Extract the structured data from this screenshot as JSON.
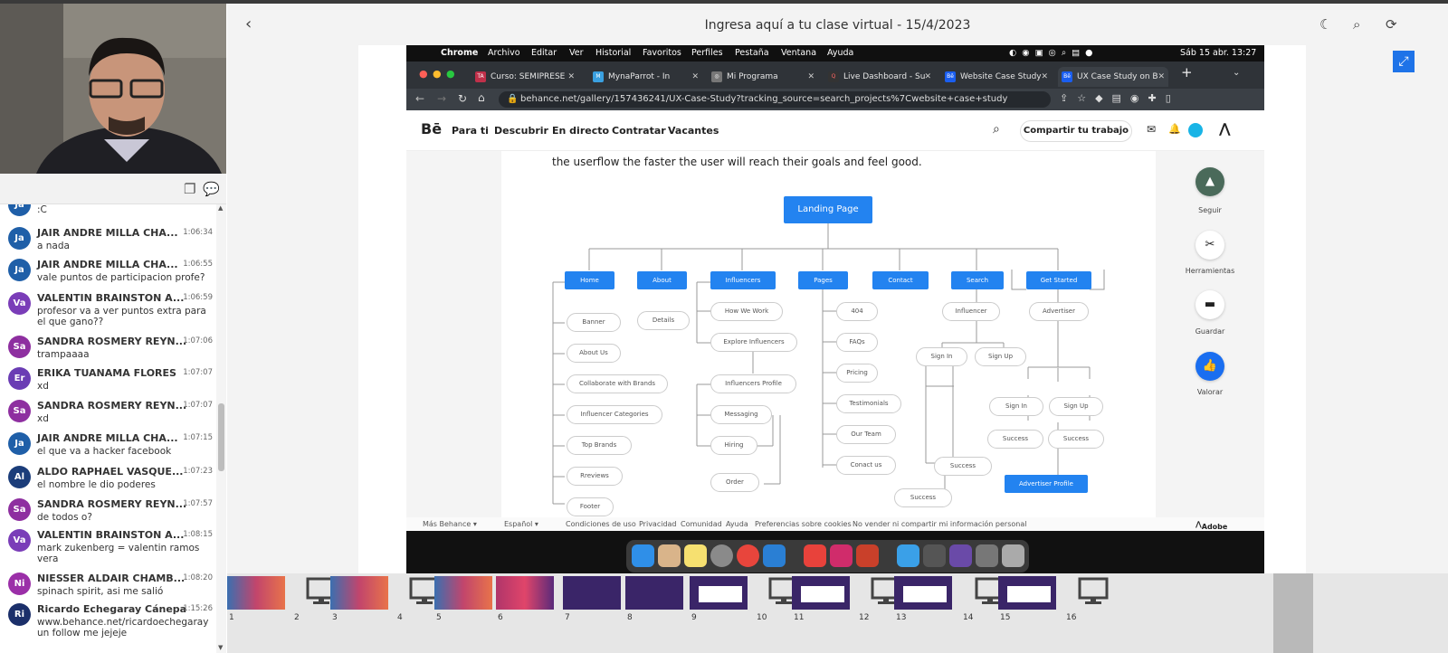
{
  "header": {
    "title": "Ingresa aquí a tu clase virtual - 15/4/2023",
    "back_icon": "chevron-left-icon",
    "theme_icon": "moon-icon",
    "search_icon": "search-icon",
    "rotate_icon": "rotate-icon"
  },
  "chat": {
    "messages": [
      {
        "initials": "Ja",
        "color": "#1f5fa8",
        "name": "",
        "time": "",
        "text": ":C"
      },
      {
        "initials": "Ja",
        "color": "#1f5fa8",
        "name": "JAIR ANDRE MILLA CHA...",
        "time": "1:06:34",
        "text": "a nada"
      },
      {
        "initials": "Ja",
        "color": "#1f5fa8",
        "name": "JAIR ANDRE MILLA CHA...",
        "time": "1:06:55",
        "text": "vale puntos de participacion profe?"
      },
      {
        "initials": "Va",
        "color": "#7a3db8",
        "name": "VALENTIN BRAINSTON A...",
        "time": "1:06:59",
        "text": "profesor va a ver puntos extra para el que gano??"
      },
      {
        "initials": "Sa",
        "color": "#8e2fa0",
        "name": "SANDRA ROSMERY REYN...",
        "time": "1:07:06",
        "text": "trampaaaa"
      },
      {
        "initials": "Er",
        "color": "#6a3cb4",
        "name": "ERIKA TUANAMA FLORES",
        "time": "1:07:07",
        "text": "xd"
      },
      {
        "initials": "Sa",
        "color": "#8e2fa0",
        "name": "SANDRA ROSMERY REYN...",
        "time": "1:07:07",
        "text": "xd"
      },
      {
        "initials": "Ja",
        "color": "#1f5fa8",
        "name": "JAIR ANDRE MILLA CHA...",
        "time": "1:07:15",
        "text": "el que va a hacker facebook"
      },
      {
        "initials": "Al",
        "color": "#1b3d7a",
        "name": "ALDO RAPHAEL VASQUE...",
        "time": "1:07:23",
        "text": "el nombre le dio poderes"
      },
      {
        "initials": "Sa",
        "color": "#8e2fa0",
        "name": "SANDRA ROSMERY REYN...",
        "time": "1:07:57",
        "text": "de todos o?"
      },
      {
        "initials": "Va",
        "color": "#7a3db8",
        "name": "VALENTIN BRAINSTON A...",
        "time": "1:08:15",
        "text": "mark zukenberg = valentin ramos vera"
      },
      {
        "initials": "Ni",
        "color": "#9b2fa8",
        "name": "NIESSER ALDAIR CHAMB...",
        "time": "1:08:20",
        "text": "spinach spirit, asi me salió"
      },
      {
        "initials": "Ri",
        "color": "#1b2f6a",
        "name": "Ricardo Echegaray Cánepa",
        "time": "1:15:26",
        "text": "www.behance.net/ricardoechegaray un follow me jejeje"
      }
    ]
  },
  "mac": {
    "menubar": [
      "Chrome",
      "Archivo",
      "Editar",
      "Ver",
      "Historial",
      "Favoritos",
      "Perfiles",
      "Pestaña",
      "Ventana",
      "Ayuda"
    ],
    "clock": "Sáb 15 abr. 13:27",
    "tabs": [
      "Curso: SEMIPRESE",
      "MynaParrot - In",
      "Mi Programa",
      "Live Dashboard - Su",
      "Website Case Study",
      "UX Case Study on B"
    ],
    "url": "behance.net/gallery/157436241/UX-Case-Study?tracking_source=search_projects%7Cwebsite+case+study",
    "behance": {
      "logo": "Bē",
      "nav": [
        "Para ti",
        "Descubrir",
        "En directo",
        "Contratar",
        "Vacantes"
      ],
      "share": "Compartir tu trabajo"
    },
    "intro": "the userflow the faster the user will reach their goals and feel good.",
    "landing": "Landing Page",
    "sections": [
      "Home",
      "About",
      "Influencers",
      "Pages",
      "Contact",
      "Search",
      "Get Started"
    ],
    "home_items": [
      "Banner",
      "About Us",
      "Collaborate with Brands",
      "Influencer Categories",
      "Top Brands",
      "Rreviews",
      "Footer"
    ],
    "about_items": [
      "Details"
    ],
    "influencer_items": [
      "How We Work",
      "Explore Influencers",
      "Influencers Profile",
      "Messaging",
      "Hiring",
      "Order"
    ],
    "pages_items": [
      "404",
      "FAQs",
      "Pricing",
      "Testimonials",
      "Our Team",
      "Conact us"
    ],
    "search_items": [
      "Influencer",
      "Sign In",
      "Sign Up",
      "Success",
      "Success"
    ],
    "started_items": [
      "Advertiser",
      "Sign In",
      "Sign Up",
      "Success",
      "Success",
      "Advertiser Profile"
    ],
    "side_actions": [
      "Seguir",
      "Herramientas",
      "Guardar",
      "Valorar"
    ],
    "footer": [
      "Más Behance ▾",
      "Español ▾",
      "Condiciones de uso",
      "Privacidad",
      "Comunidad",
      "Ayuda",
      "Preferencias sobre cookies",
      "No vender ni compartir mi información personal"
    ],
    "adobe": "Adobe"
  },
  "slides": [
    "1",
    "2",
    "3",
    "4",
    "5",
    "6",
    "7",
    "8",
    "9",
    "10",
    "11",
    "12",
    "13",
    "14",
    "15",
    "16"
  ],
  "current_slide": "10"
}
